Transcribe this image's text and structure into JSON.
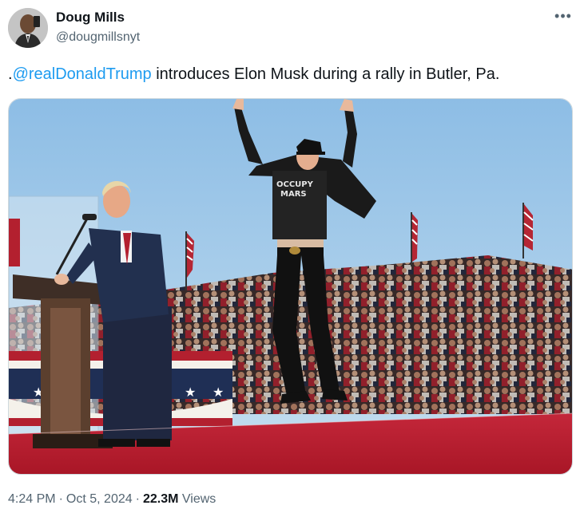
{
  "author": {
    "name": "Doug Mills",
    "handle": "@dougmillsnyt"
  },
  "more_icon": "more-horizontal-icon",
  "tweet": {
    "prefix": ".",
    "mention": "@realDonaldTrump",
    "body": " introduces Elon Musk during a rally in Butler, Pa."
  },
  "image": {
    "shirt_text_top": "OCCUPY",
    "shirt_text_bottom": "MARS"
  },
  "meta": {
    "time": "4:24 PM",
    "separator": "·",
    "date": "Oct 5, 2024",
    "views_count": "22.3M",
    "views_label": "Views"
  },
  "colors": {
    "link": "#1d9bf0",
    "secondary_text": "#536471",
    "stage_red": "#c81e2e",
    "sky": "#9fc6e6"
  }
}
